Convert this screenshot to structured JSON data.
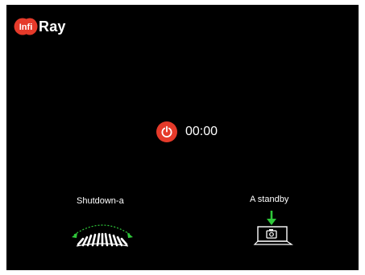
{
  "brand": {
    "logo_text": "Ray",
    "badge_text": "Infi",
    "badge_color": "#e53a2a"
  },
  "status": {
    "power_icon": "power-icon",
    "timer": "00:00",
    "accent_color": "#e53a2a"
  },
  "options": {
    "left": {
      "label": "Shutdown-a",
      "icon": "rotary-dial-icon"
    },
    "right": {
      "label": "A standby",
      "icon": "press-button-icon",
      "arrow_color": "#2fc83a"
    }
  }
}
